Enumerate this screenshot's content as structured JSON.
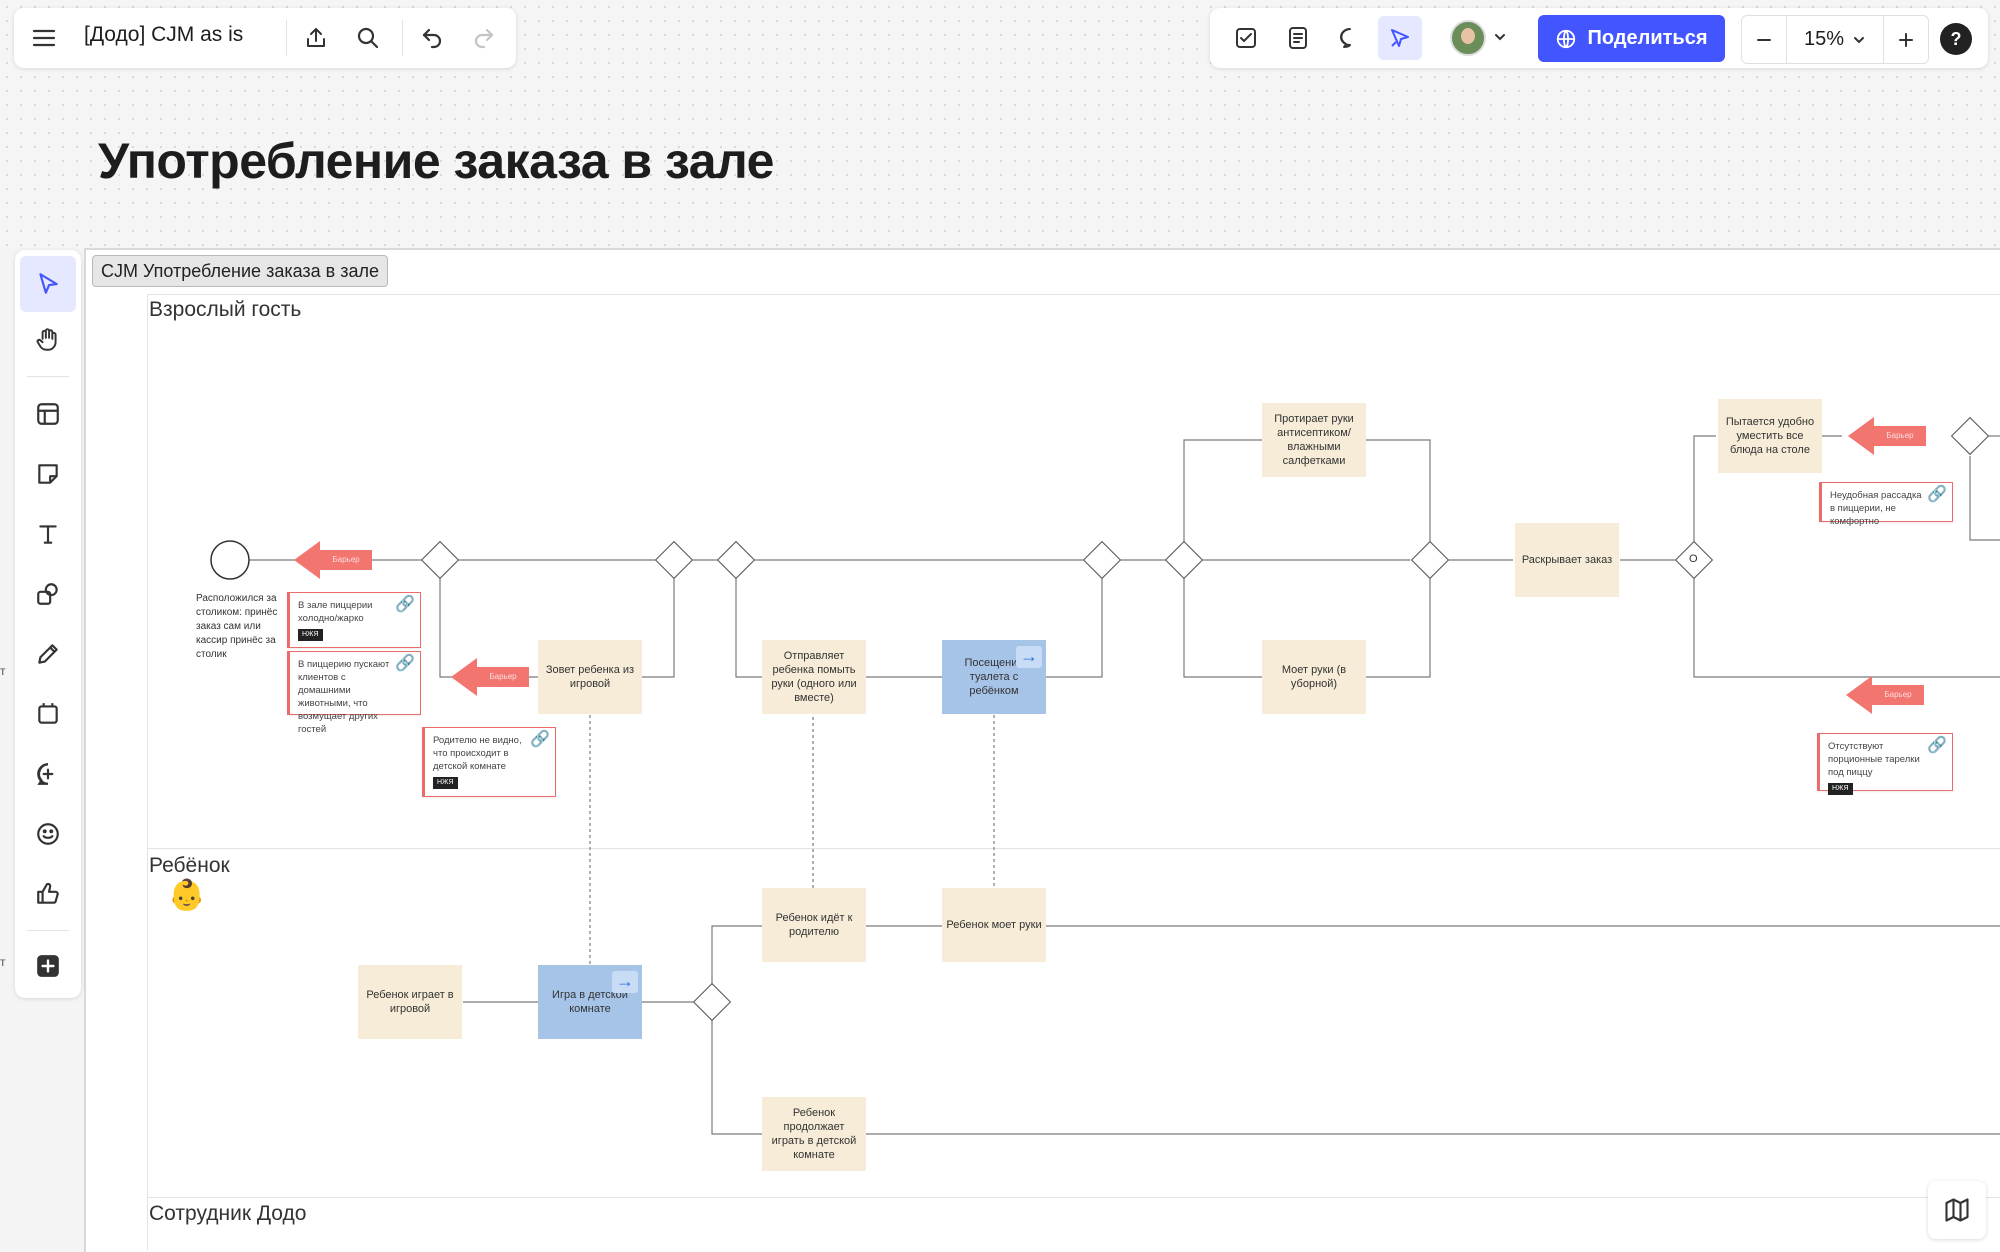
{
  "toolbar": {
    "board_title": "[Додо] CJM as is",
    "share_label": "Поделиться",
    "zoom_level": "15%",
    "help_label": "?",
    "icons": [
      "menu-icon",
      "upload-icon",
      "search-icon",
      "undo-icon",
      "redo-icon",
      "checklist-icon",
      "document-icon",
      "comment-icon",
      "cursor-presence-icon",
      "globe-icon",
      "minus-icon",
      "plus-icon",
      "chevron-down-icon"
    ]
  },
  "page": {
    "heading": "Употребление заказа в зале",
    "frame_tag": "CJM Употребление заказа в зале"
  },
  "lanes": {
    "adult": "Взрослый гость",
    "child": "Ребёнок",
    "staff": "Сотрудник Додо"
  },
  "left_tools": [
    "select-tool",
    "hand-tool",
    "template-tool",
    "sticky-note-tool",
    "text-tool",
    "shapes-tool",
    "pen-tool",
    "frame-tool",
    "comment-tool",
    "reaction-tool",
    "like-tool",
    "add-tool"
  ],
  "flow": {
    "start_note": "Расположился за столиком: принёс заказ сам или кассир принёс за столик",
    "call_child": "Зовет ребенка из игровой",
    "send_wash": "Отправляет ребенка помыть руки (одного или вместе)",
    "toilet_visit": "Посещение туалета с ребёнком",
    "wipe_hands": "Протирает руки антисептиком/влажными салфетками",
    "wash_hands": "Моет руки (в уборной)",
    "unpack_order": "Раскрывает заказ",
    "fit_dishes": "Пытается удобно уместить все блюда на столе",
    "gateway_o": "O",
    "child_plays": "Ребенок играет в игровой",
    "play_room": "Игра в детской комнате",
    "child_goes": "Ребенок идёт к родителю",
    "child_washes": "Ребенок моет руки",
    "child_continues": "Ребенок продолжает играть в детской комнате"
  },
  "barriers": {
    "label": "Барьер"
  },
  "cards": {
    "cold_hot": "В зале пиццерии холодно/жарко",
    "pets": "В пиццерию пускают клиентов с домашними животными, что возмущает других гостей",
    "parent_cant_see": "Родителю не видно, что происходит в детской комнате",
    "seating": "Неудобная рассадка в пиццерии, не комфортно",
    "plates": "Отсутствуют порционные тарелки под пиццу",
    "tag": "НЖЯ"
  },
  "edge_letters": [
    "т",
    "т"
  ],
  "colors": {
    "accent": "#4255ff",
    "node_beige": "#f6ecd8",
    "node_blue": "#a6c3e8",
    "barrier_red": "#f27570",
    "card_border": "#ec6b6b"
  }
}
